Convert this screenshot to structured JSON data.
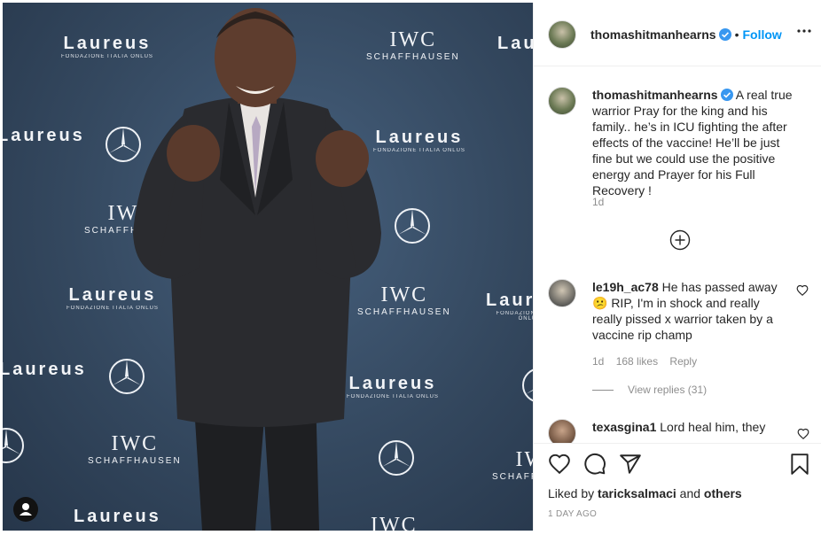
{
  "post": {
    "username": "thomashitmanhearns",
    "follow_label": "Follow",
    "separator": "•"
  },
  "caption": {
    "username": "thomashitmanhearns",
    "text": "A real true warrior Pray for the king and his family.. he’s in ICU fighting the after effects of the vaccine! He’ll be just fine but we could use the positive energy and Prayer for his Full Recovery !",
    "age": "1d"
  },
  "comments": [
    {
      "username": "le19h_ac78",
      "text": "He has passed away 😕 RIP, I'm in shock and really really pissed x warrior taken by a vaccine rip champ",
      "age": "1d",
      "likes": "168 likes",
      "reply_label": "Reply",
      "view_replies": "View replies (31)"
    },
    {
      "username": "texasgina1",
      "text": "Lord heal him, they"
    }
  ],
  "likes": {
    "prefix": "Liked by",
    "user": "taricksalmaci",
    "conj": "and",
    "others": "others"
  },
  "timestamp": "1 DAY AGO",
  "photo": {
    "backdrop": [
      {
        "brand": "laureus",
        "word": "Laureus",
        "sub": "FONDAZIONE ITALIA ONLUS"
      },
      {
        "brand": "iwc",
        "word": "IWC",
        "sub": "SCHAFFHAUSEN"
      }
    ]
  },
  "colors": {
    "accent": "#0095f6",
    "verified": "#3897f0",
    "text": "#262626",
    "muted": "#8e8e8e",
    "backdrop": "#34485f"
  },
  "icons": [
    "verified-badge-icon",
    "more-options-icon",
    "add-comment-icon",
    "heart-icon",
    "comment-icon",
    "share-icon",
    "bookmark-icon",
    "user-tag-icon"
  ]
}
